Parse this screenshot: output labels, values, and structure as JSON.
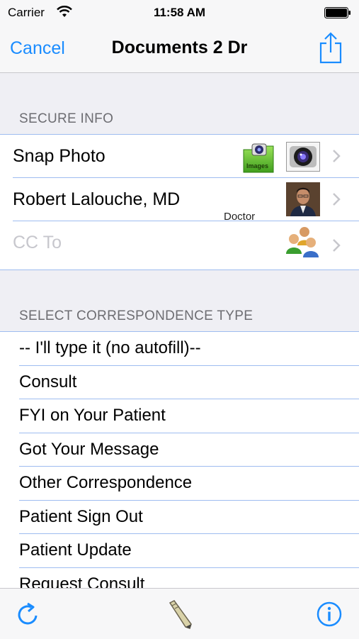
{
  "status_bar": {
    "carrier": "Carrier",
    "time": "11:58 AM"
  },
  "nav": {
    "cancel_label": "Cancel",
    "title": "Documents 2 Dr"
  },
  "secure_info": {
    "header": "SECURE INFO",
    "rows": [
      {
        "label": "Snap Photo"
      },
      {
        "label": "Robert Lalouche, MD",
        "sublabel": "Doctor"
      },
      {
        "label": "CC To"
      }
    ],
    "images_folder_text": "Images"
  },
  "correspondence": {
    "header": "SELECT CORRESPONDENCE TYPE",
    "items": [
      "-- I'll type it (no autofill)--",
      "Consult",
      "FYI on Your Patient",
      "Got Your Message",
      "Other Correspondence",
      "Patient Sign Out",
      "Patient Update",
      "Request Consult"
    ]
  },
  "colors": {
    "accent": "#1a8cff",
    "separator": "#9ebcf0"
  },
  "icons": [
    "wifi-icon",
    "battery-icon",
    "share-icon",
    "images-folder-icon",
    "camera-icon",
    "doctor-photo",
    "contacts-group-icon",
    "chevron-right-icon",
    "refresh-icon",
    "pen-icon",
    "info-icon"
  ]
}
